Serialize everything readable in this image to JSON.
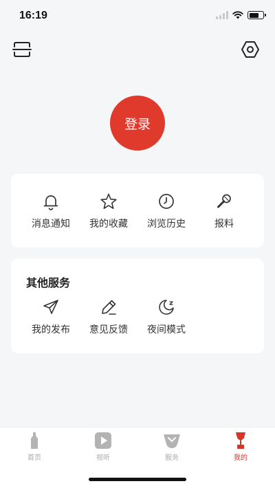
{
  "status_bar": {
    "time": "16:19"
  },
  "profile": {
    "login_label": "登录"
  },
  "shortcuts": [
    {
      "label": "消息通知",
      "icon": "bell-icon"
    },
    {
      "label": "我的收藏",
      "icon": "star-icon"
    },
    {
      "label": "浏览历史",
      "icon": "clock-icon"
    },
    {
      "label": "报料",
      "icon": "microphone-icon"
    }
  ],
  "other_services": {
    "title": "其他服务",
    "items": [
      {
        "label": "我的发布",
        "icon": "paper-plane-icon"
      },
      {
        "label": "意见反馈",
        "icon": "pencil-icon"
      },
      {
        "label": "夜间模式",
        "icon": "moon-icon"
      }
    ]
  },
  "tabbar": {
    "tabs": [
      {
        "label": "首页",
        "icon": "home-bottle-icon",
        "active": false
      },
      {
        "label": "视听",
        "icon": "play-icon",
        "active": false
      },
      {
        "label": "服务",
        "icon": "services-vessel-icon",
        "active": false
      },
      {
        "label": "我的",
        "icon": "profile-goblet-icon",
        "active": true
      }
    ]
  },
  "colors": {
    "accent": "#df3a2c",
    "background": "#f5f6f8",
    "card": "#ffffff",
    "inactive": "#aaaaaa"
  }
}
